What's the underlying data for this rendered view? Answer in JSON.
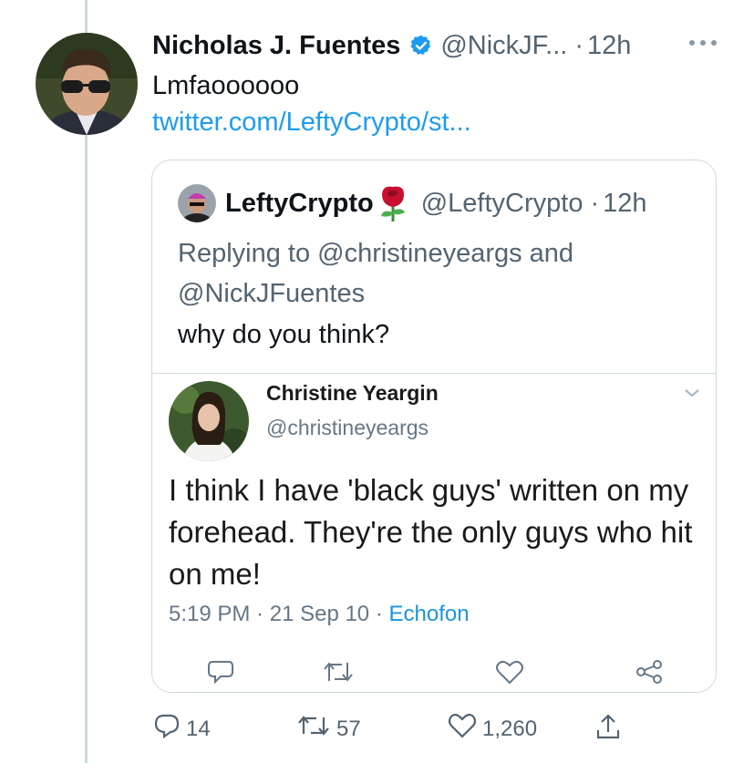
{
  "tweet": {
    "author_name": "Nicholas J. Fuentes",
    "author_handle": "@NickJF...",
    "separator": "·",
    "time": "12h",
    "text": "Lmfaoooooo",
    "link": "twitter.com/LeftyCrypto/st..."
  },
  "quote": {
    "author_name": "LeftyCrypto",
    "author_handle": "@LeftyCrypto",
    "separator": "·",
    "time": "12h",
    "replying_line1": "Replying to @christineyeargs and",
    "replying_line2": "@NickJFuentes",
    "text": "why do you think?"
  },
  "embedded": {
    "author_name": "Christine Yeargin",
    "author_handle": "@christineyeargs",
    "text": "I think I have 'black guys' written on my forehead. They're the only guys who hit on me!",
    "time": "5:19 PM",
    "separator": " · ",
    "date": "21 Sep 10",
    "source": "Echofon"
  },
  "actions": {
    "replies": "14",
    "retweets": "57",
    "likes": "1,260"
  },
  "colors": {
    "accent": "#1d9bf0",
    "secondary_text": "#536471",
    "border": "#cfd9de"
  },
  "icons": [
    "verified-badge-icon",
    "rose-emoji-icon",
    "more-icon",
    "chevron-down-icon",
    "reply-icon",
    "retweet-icon",
    "like-icon",
    "share-icon"
  ]
}
